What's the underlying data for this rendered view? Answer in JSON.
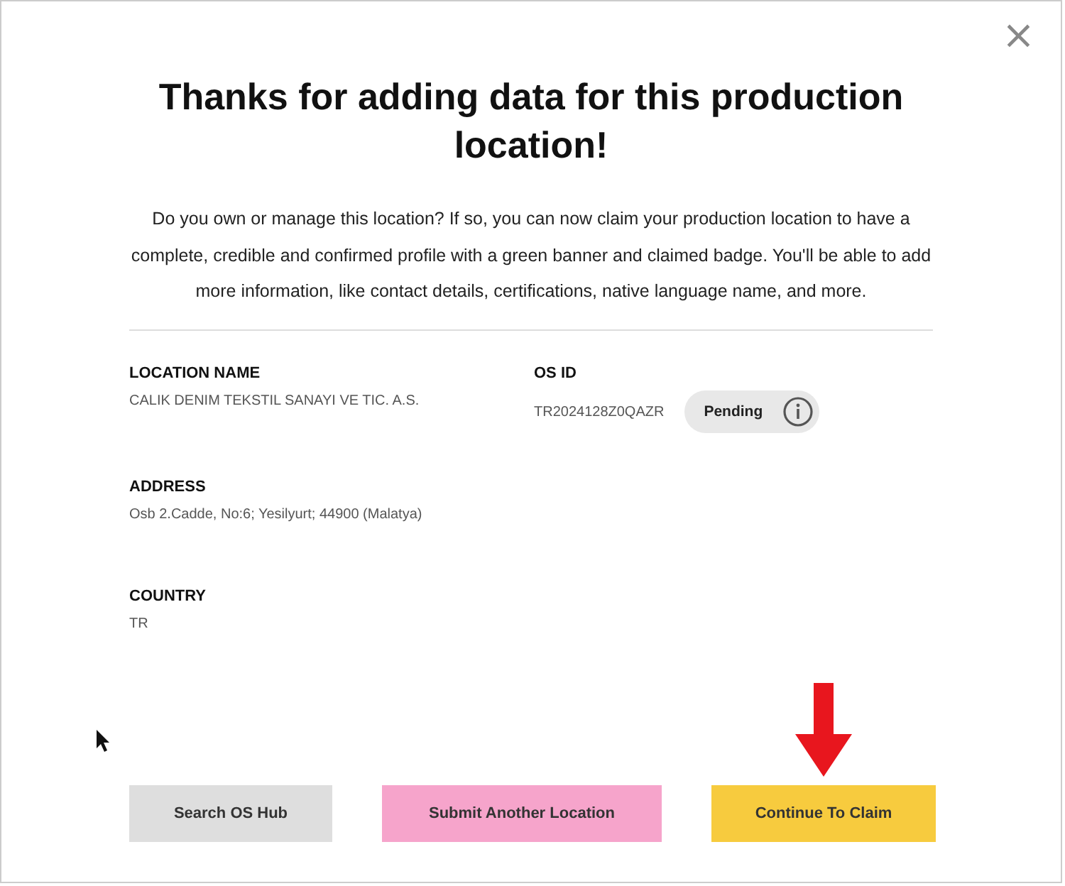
{
  "dialog": {
    "title": "Thanks for adding data for this production location!",
    "close": "×",
    "message": "Do you own or manage this location? If so, you can now claim your production location to have a complete, credible and confirmed profile with a green banner and claimed badge. You'll be able to add more information, like contact details, certifications, native language name, and more.",
    "fields": [
      {
        "label": "LOCATION NAME",
        "value": "CALIK DENIM TEKSTIL SANAYI VE TIC. A.S."
      },
      {
        "label": "OS ID",
        "value": "TR2024128Z0QAZR",
        "status": "Pending"
      },
      {
        "label": "ADDRESS",
        "value": "Osb 2.Cadde, No:6; Yesilyurt; 44900 (Malatya)"
      },
      {
        "label": "COUNTRY",
        "value": "TR"
      }
    ],
    "buttons": [
      {
        "label": "Search OS Hub",
        "kind": "grey"
      },
      {
        "label": "Submit Another Location",
        "kind": "pink"
      },
      {
        "label": "Continue To Claim",
        "kind": "yellow",
        "highlighted": true
      }
    ]
  }
}
